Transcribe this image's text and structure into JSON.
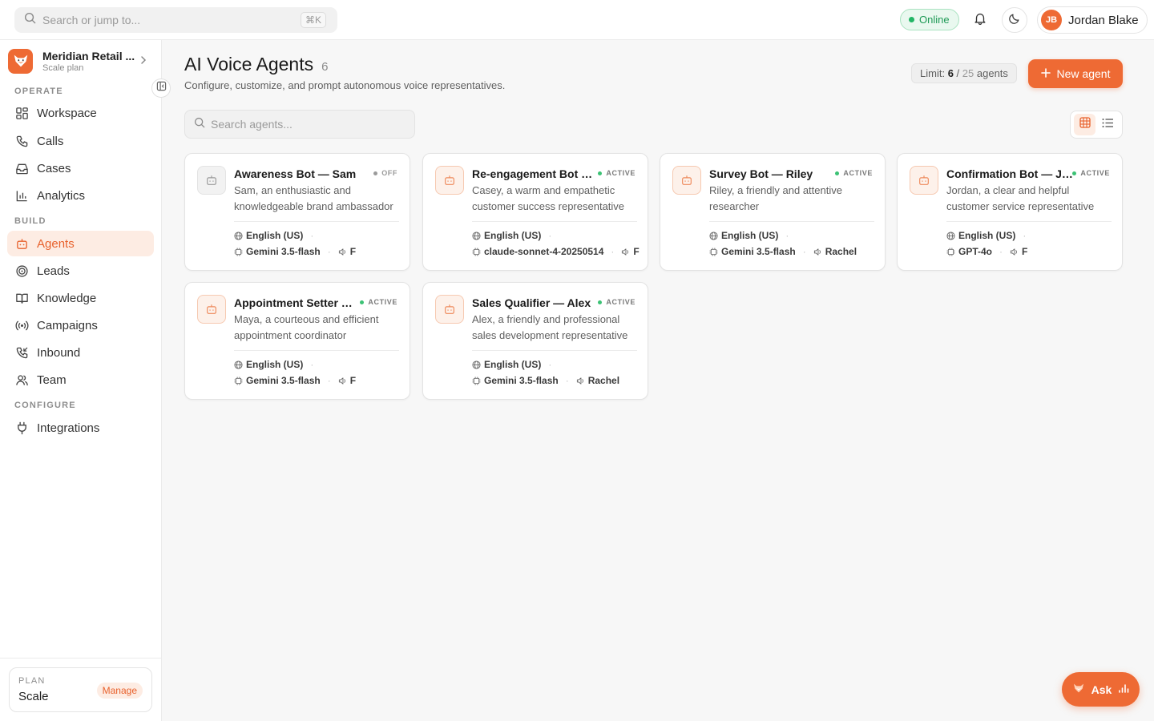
{
  "header": {
    "search_placeholder": "Search or jump to...",
    "shortcut": "⌘K",
    "status": "Online",
    "user": {
      "initials": "JB",
      "name": "Jordan Blake"
    }
  },
  "sidebar": {
    "org": {
      "name": "Meridian Retail ...",
      "plan": "Scale plan"
    },
    "sections": {
      "operate": "OPERATE",
      "build": "BUILD",
      "configure": "CONFIGURE"
    },
    "items": {
      "workspace": "Workspace",
      "calls": "Calls",
      "cases": "Cases",
      "analytics": "Analytics",
      "agents": "Agents",
      "leads": "Leads",
      "knowledge": "Knowledge",
      "campaigns": "Campaigns",
      "inbound": "Inbound",
      "team": "Team",
      "integrations": "Integrations"
    },
    "plan_box": {
      "label": "PLAN",
      "name": "Scale",
      "manage": "Manage"
    }
  },
  "main": {
    "title": "AI Voice Agents",
    "count": "6",
    "subtitle": "Configure, customize, and prompt autonomous voice representatives.",
    "limit": {
      "label": "Limit:",
      "used": "6",
      "sep": "/",
      "max": "25",
      "unit": "agents"
    },
    "new_agent": "New agent",
    "search_placeholder": "Search agents..."
  },
  "agents": [
    {
      "name": "Awareness Bot — Sam",
      "status": "OFF",
      "desc": "Sam, an enthusiastic and knowledgeable brand ambassador",
      "language": "English (US)",
      "model": "Gemini 3.5-flash",
      "voice": "F"
    },
    {
      "name": "Re-engagement Bot — Casey",
      "status": "ACTIVE",
      "desc": "Casey, a warm and empathetic customer success representative",
      "language": "English (US)",
      "model": "claude-sonnet-4-20250514",
      "voice": "F"
    },
    {
      "name": "Survey Bot — Riley",
      "status": "ACTIVE",
      "desc": "Riley, a friendly and attentive researcher",
      "language": "English (US)",
      "model": "Gemini 3.5-flash",
      "voice": "Rachel"
    },
    {
      "name": "Confirmation Bot — Jordan",
      "status": "ACTIVE",
      "desc": "Jordan, a clear and helpful customer service representative",
      "language": "English (US)",
      "model": "GPT-4o",
      "voice": "F"
    },
    {
      "name": "Appointment Setter — Maya",
      "status": "ACTIVE",
      "desc": "Maya, a courteous and efficient appointment coordinator",
      "language": "English (US)",
      "model": "Gemini 3.5-flash",
      "voice": "F"
    },
    {
      "name": "Sales Qualifier — Alex",
      "status": "ACTIVE",
      "desc": "Alex, a friendly and professional sales development representative",
      "language": "English (US)",
      "model": "Gemini 3.5-flash",
      "voice": "Rachel"
    }
  ],
  "ask_button": "Ask",
  "colors": {
    "accent": "#ee6a34",
    "online": "#22b565"
  }
}
